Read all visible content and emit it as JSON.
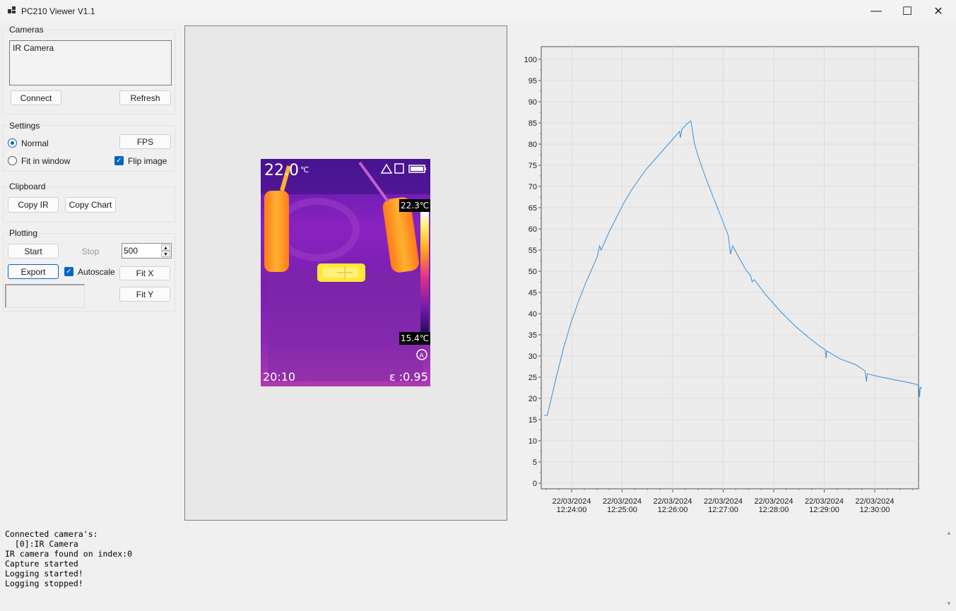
{
  "window": {
    "title": "PC210 Viewer V1.1",
    "minimize": "—",
    "maximize": "☐",
    "close": "✕"
  },
  "cameras": {
    "group_title": "Cameras",
    "list": [
      "IR Camera"
    ],
    "connect_label": "Connect",
    "refresh_label": "Refresh"
  },
  "settings": {
    "group_title": "Settings",
    "normal_label": "Normal",
    "fit_label": "Fit in window",
    "fps_label": "FPS",
    "flip_label": "Flip image",
    "selected_mode": "Normal",
    "flip_checked": true
  },
  "clipboard": {
    "group_title": "Clipboard",
    "copy_ir_label": "Copy IR",
    "copy_chart_label": "Copy Chart"
  },
  "plotting": {
    "group_title": "Plotting",
    "start_label": "Start",
    "stop_label": "Stop",
    "samples_value": "500",
    "export_label": "Export",
    "autoscale_label": "Autoscale",
    "autoscale_checked": true,
    "fitx_label": "Fit X",
    "fity_label": "Fit Y"
  },
  "ir_image": {
    "center_temp": "22.0",
    "center_unit": "℃",
    "max_temp": "22.3℃",
    "min_temp": "15.4℃",
    "time": "20:10",
    "emissivity": "ε :0.95",
    "auto_badge": "A"
  },
  "chart_data": {
    "type": "line",
    "y_ticks": [
      "100",
      "95",
      "90",
      "85",
      "80",
      "75",
      "70",
      "65",
      "60",
      "55",
      "50",
      "45",
      "40",
      "35",
      "30",
      "25",
      "20",
      "15",
      "10",
      "5",
      "0"
    ],
    "ylim": [
      0,
      100
    ],
    "x_tick_dates": [
      "22/03/2024",
      "22/03/2024",
      "22/03/2024",
      "22/03/2024",
      "22/03/2024",
      "22/03/2024",
      "22/03/2024"
    ],
    "x_tick_times": [
      "12:24:00",
      "12:25:00",
      "12:26:00",
      "12:27:00",
      "12:28:00",
      "12:29:00",
      "12:30:00"
    ],
    "xlim_seconds_from_start": [
      0,
      450
    ],
    "grid": true,
    "series": [
      {
        "color": "#3b8fd8",
        "points": [
          [
            4,
            16
          ],
          [
            8,
            16
          ],
          [
            12,
            19
          ],
          [
            20,
            25
          ],
          [
            30,
            32
          ],
          [
            40,
            38
          ],
          [
            50,
            43
          ],
          [
            60,
            47.5
          ],
          [
            70,
            51.5
          ],
          [
            75,
            53.5
          ],
          [
            78,
            56
          ],
          [
            80,
            55
          ],
          [
            90,
            59
          ],
          [
            100,
            62.5
          ],
          [
            110,
            66
          ],
          [
            120,
            69
          ],
          [
            130,
            71.5
          ],
          [
            140,
            74
          ],
          [
            150,
            76
          ],
          [
            160,
            78
          ],
          [
            170,
            80
          ],
          [
            180,
            82
          ],
          [
            185,
            83
          ],
          [
            186,
            81.5
          ],
          [
            188,
            83.5
          ],
          [
            195,
            84.8
          ],
          [
            200,
            85.5
          ],
          [
            205,
            80
          ],
          [
            210,
            77
          ],
          [
            220,
            72
          ],
          [
            230,
            67.5
          ],
          [
            240,
            63
          ],
          [
            250,
            58.5
          ],
          [
            253,
            54
          ],
          [
            256,
            56
          ],
          [
            265,
            53
          ],
          [
            275,
            50
          ],
          [
            280,
            49
          ],
          [
            282,
            47.5
          ],
          [
            285,
            48
          ],
          [
            300,
            44.5
          ],
          [
            320,
            40.5
          ],
          [
            340,
            37
          ],
          [
            360,
            34
          ],
          [
            375,
            32
          ],
          [
            380,
            31.5
          ],
          [
            381,
            29.5
          ],
          [
            382,
            31.2
          ],
          [
            400,
            29.3
          ],
          [
            420,
            28
          ],
          [
            433,
            26.5
          ],
          [
            435,
            24
          ],
          [
            436,
            25.8
          ],
          [
            455,
            25
          ],
          [
            475,
            24.3
          ],
          [
            490,
            23.8
          ],
          [
            500,
            23.4
          ],
          [
            505,
            23
          ],
          [
            506,
            20.3
          ],
          [
            507,
            22.6
          ],
          [
            510,
            22.4
          ],
          [
            511,
            19.6
          ],
          [
            512,
            22.3
          ],
          [
            517,
            22
          ]
        ]
      }
    ]
  },
  "log": {
    "lines": [
      "Connected camera's:",
      "  [0]:IR Camera",
      "IR camera found on index:0",
      "Capture started",
      "Logging started!",
      "Logging stopped!"
    ]
  },
  "colors": {
    "accent": "#0067c0",
    "series": "#3b8fd8"
  }
}
